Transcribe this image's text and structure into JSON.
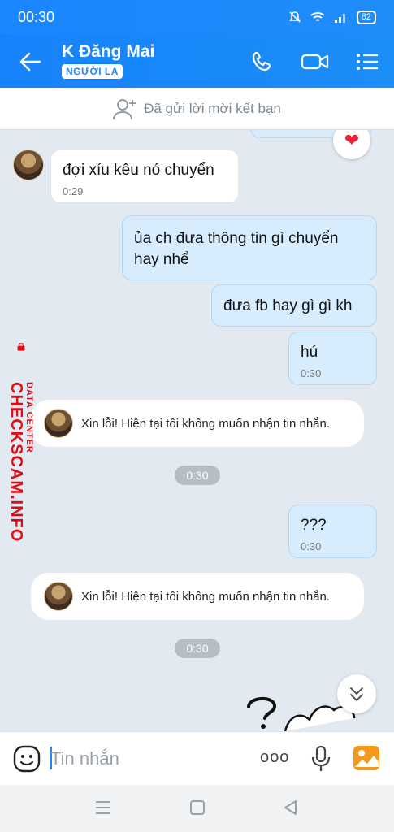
{
  "status": {
    "time": "00:30",
    "battery": "62"
  },
  "header": {
    "name": "K Đăng Mai",
    "badge": "NGƯỜI LẠ"
  },
  "friend_request": {
    "text": "Đã gửi lời mời kết bạn"
  },
  "messages": [
    {
      "text": "đợi xíu kêu nó chuyển",
      "time": "0:29"
    },
    {
      "text": "ủa ch đưa thông tin gì chuyển hay nhể"
    },
    {
      "text": "đưa fb hay gì gì kh"
    },
    {
      "text": "hú",
      "time": "0:30"
    },
    {
      "text": "Xin lỗi! Hiện tại tôi không muốn nhận tin nhắn."
    },
    {
      "time": "0:30"
    },
    {
      "text": "???",
      "time": "0:30"
    },
    {
      "text": "Xin lỗi! Hiện tại tôi không muốn nhận tin nhắn."
    },
    {
      "time": "0:30"
    }
  ],
  "watermark": {
    "main": "CHECKSCAM.INFO",
    "sub": "DATA CENTER"
  },
  "input": {
    "placeholder": "Tin nhắn",
    "more": "ooo"
  },
  "colors": {
    "header": "#1a86ff",
    "out_bubble": "#d7ecfd",
    "background": "#e2e9f1",
    "watermark": "#e10b14"
  }
}
